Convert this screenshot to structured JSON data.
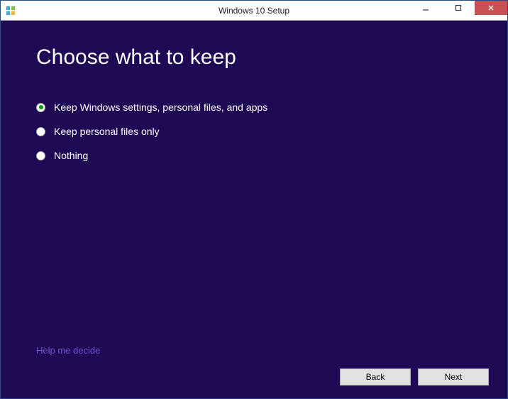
{
  "window": {
    "title": "Windows 10 Setup"
  },
  "page": {
    "heading": "Choose what to keep"
  },
  "options": [
    {
      "label": "Keep Windows settings, personal files, and apps",
      "selected": true
    },
    {
      "label": "Keep personal files only",
      "selected": false
    },
    {
      "label": "Nothing",
      "selected": false
    }
  ],
  "help_link": "Help me decide",
  "buttons": {
    "back": "Back",
    "next": "Next"
  },
  "colors": {
    "content_bg": "#1e0a54",
    "accent_radio": "#00a000",
    "link": "#7a4fd1",
    "close_btn": "#c75050"
  }
}
